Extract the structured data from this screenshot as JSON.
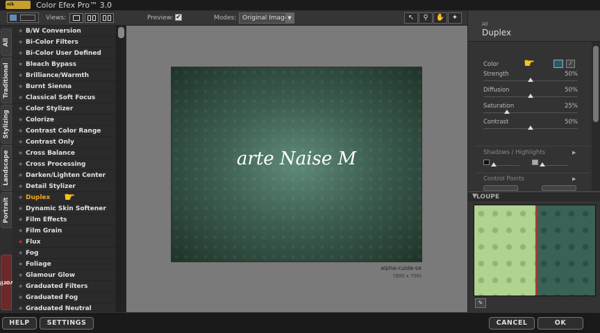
{
  "window": {
    "title": "Color Efex Pro™ 3.0"
  },
  "toolbar": {
    "views_label": "Views:",
    "preview_label": "Preview:",
    "preview_checked": "✔",
    "modes_label": "Modes:",
    "modes_value": "Original Image"
  },
  "sidetabs": [
    "All",
    "Traditional",
    "Stylizing",
    "Landscape",
    "Portrait",
    "Favorites"
  ],
  "filters": [
    {
      "label": "B/W Conversion"
    },
    {
      "label": "Bi-Color Filters"
    },
    {
      "label": "Bi-Color User Defined"
    },
    {
      "label": "Bleach Bypass"
    },
    {
      "label": "Brilliance/Warmth"
    },
    {
      "label": "Burnt Sienna"
    },
    {
      "label": "Classical Soft Focus"
    },
    {
      "label": "Color Stylizer"
    },
    {
      "label": "Colorize"
    },
    {
      "label": "Contrast Color Range"
    },
    {
      "label": "Contrast Only"
    },
    {
      "label": "Cross Balance"
    },
    {
      "label": "Cross Processing"
    },
    {
      "label": "Darken/Lighten Center"
    },
    {
      "label": "Detail Stylizer"
    },
    {
      "label": "Duplex"
    },
    {
      "label": "Dynamic Skin Softener"
    },
    {
      "label": "Film Effects"
    },
    {
      "label": "Film Grain"
    },
    {
      "label": "Flux"
    },
    {
      "label": "Fog"
    },
    {
      "label": "Foliage"
    },
    {
      "label": "Glamour Glow"
    },
    {
      "label": "Graduated Filters"
    },
    {
      "label": "Graduated Fog"
    },
    {
      "label": "Graduated Neutral Density"
    }
  ],
  "active_filter": "Duplex",
  "preview": {
    "watermark": "arte Naise M",
    "filename": "alpha-cuide-se",
    "dimensions": "(900 x 700)"
  },
  "panel": {
    "category": "All",
    "filter_name": "Duplex",
    "color_label": "Color",
    "color_value": "#2a5a6a",
    "params": [
      {
        "label": "Strength",
        "value": "50%",
        "level": 0.5
      },
      {
        "label": "Diffusion",
        "value": "50%",
        "level": 0.5
      },
      {
        "label": "Saturation",
        "value": "25%",
        "level": 0.25
      },
      {
        "label": "Contrast",
        "value": "50%",
        "level": 0.5
      }
    ],
    "shadows_highlights": "Shadows / Highlights",
    "control_points": "Control Points",
    "loupe": "LOUPE"
  },
  "bottom": {
    "help": "HELP",
    "settings": "SETTINGS",
    "cancel": "CANCEL",
    "ok": "OK"
  }
}
